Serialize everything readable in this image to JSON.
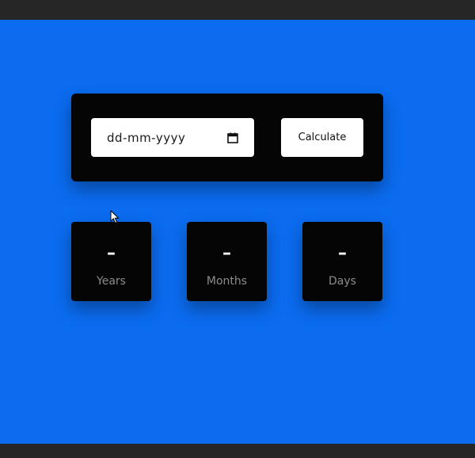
{
  "date_input": {
    "placeholder": "dd-mm-yyyy",
    "icon": "calendar-icon"
  },
  "calculate_button": {
    "label": "Calculate"
  },
  "results": {
    "years": {
      "value": "–",
      "label": "Years"
    },
    "months": {
      "value": "–",
      "label": "Months"
    },
    "days": {
      "value": "–",
      "label": "Days"
    }
  },
  "colors": {
    "background": "#0b6cf0",
    "card": "#050505",
    "label": "#8c8c8c",
    "frame": "#262626"
  }
}
